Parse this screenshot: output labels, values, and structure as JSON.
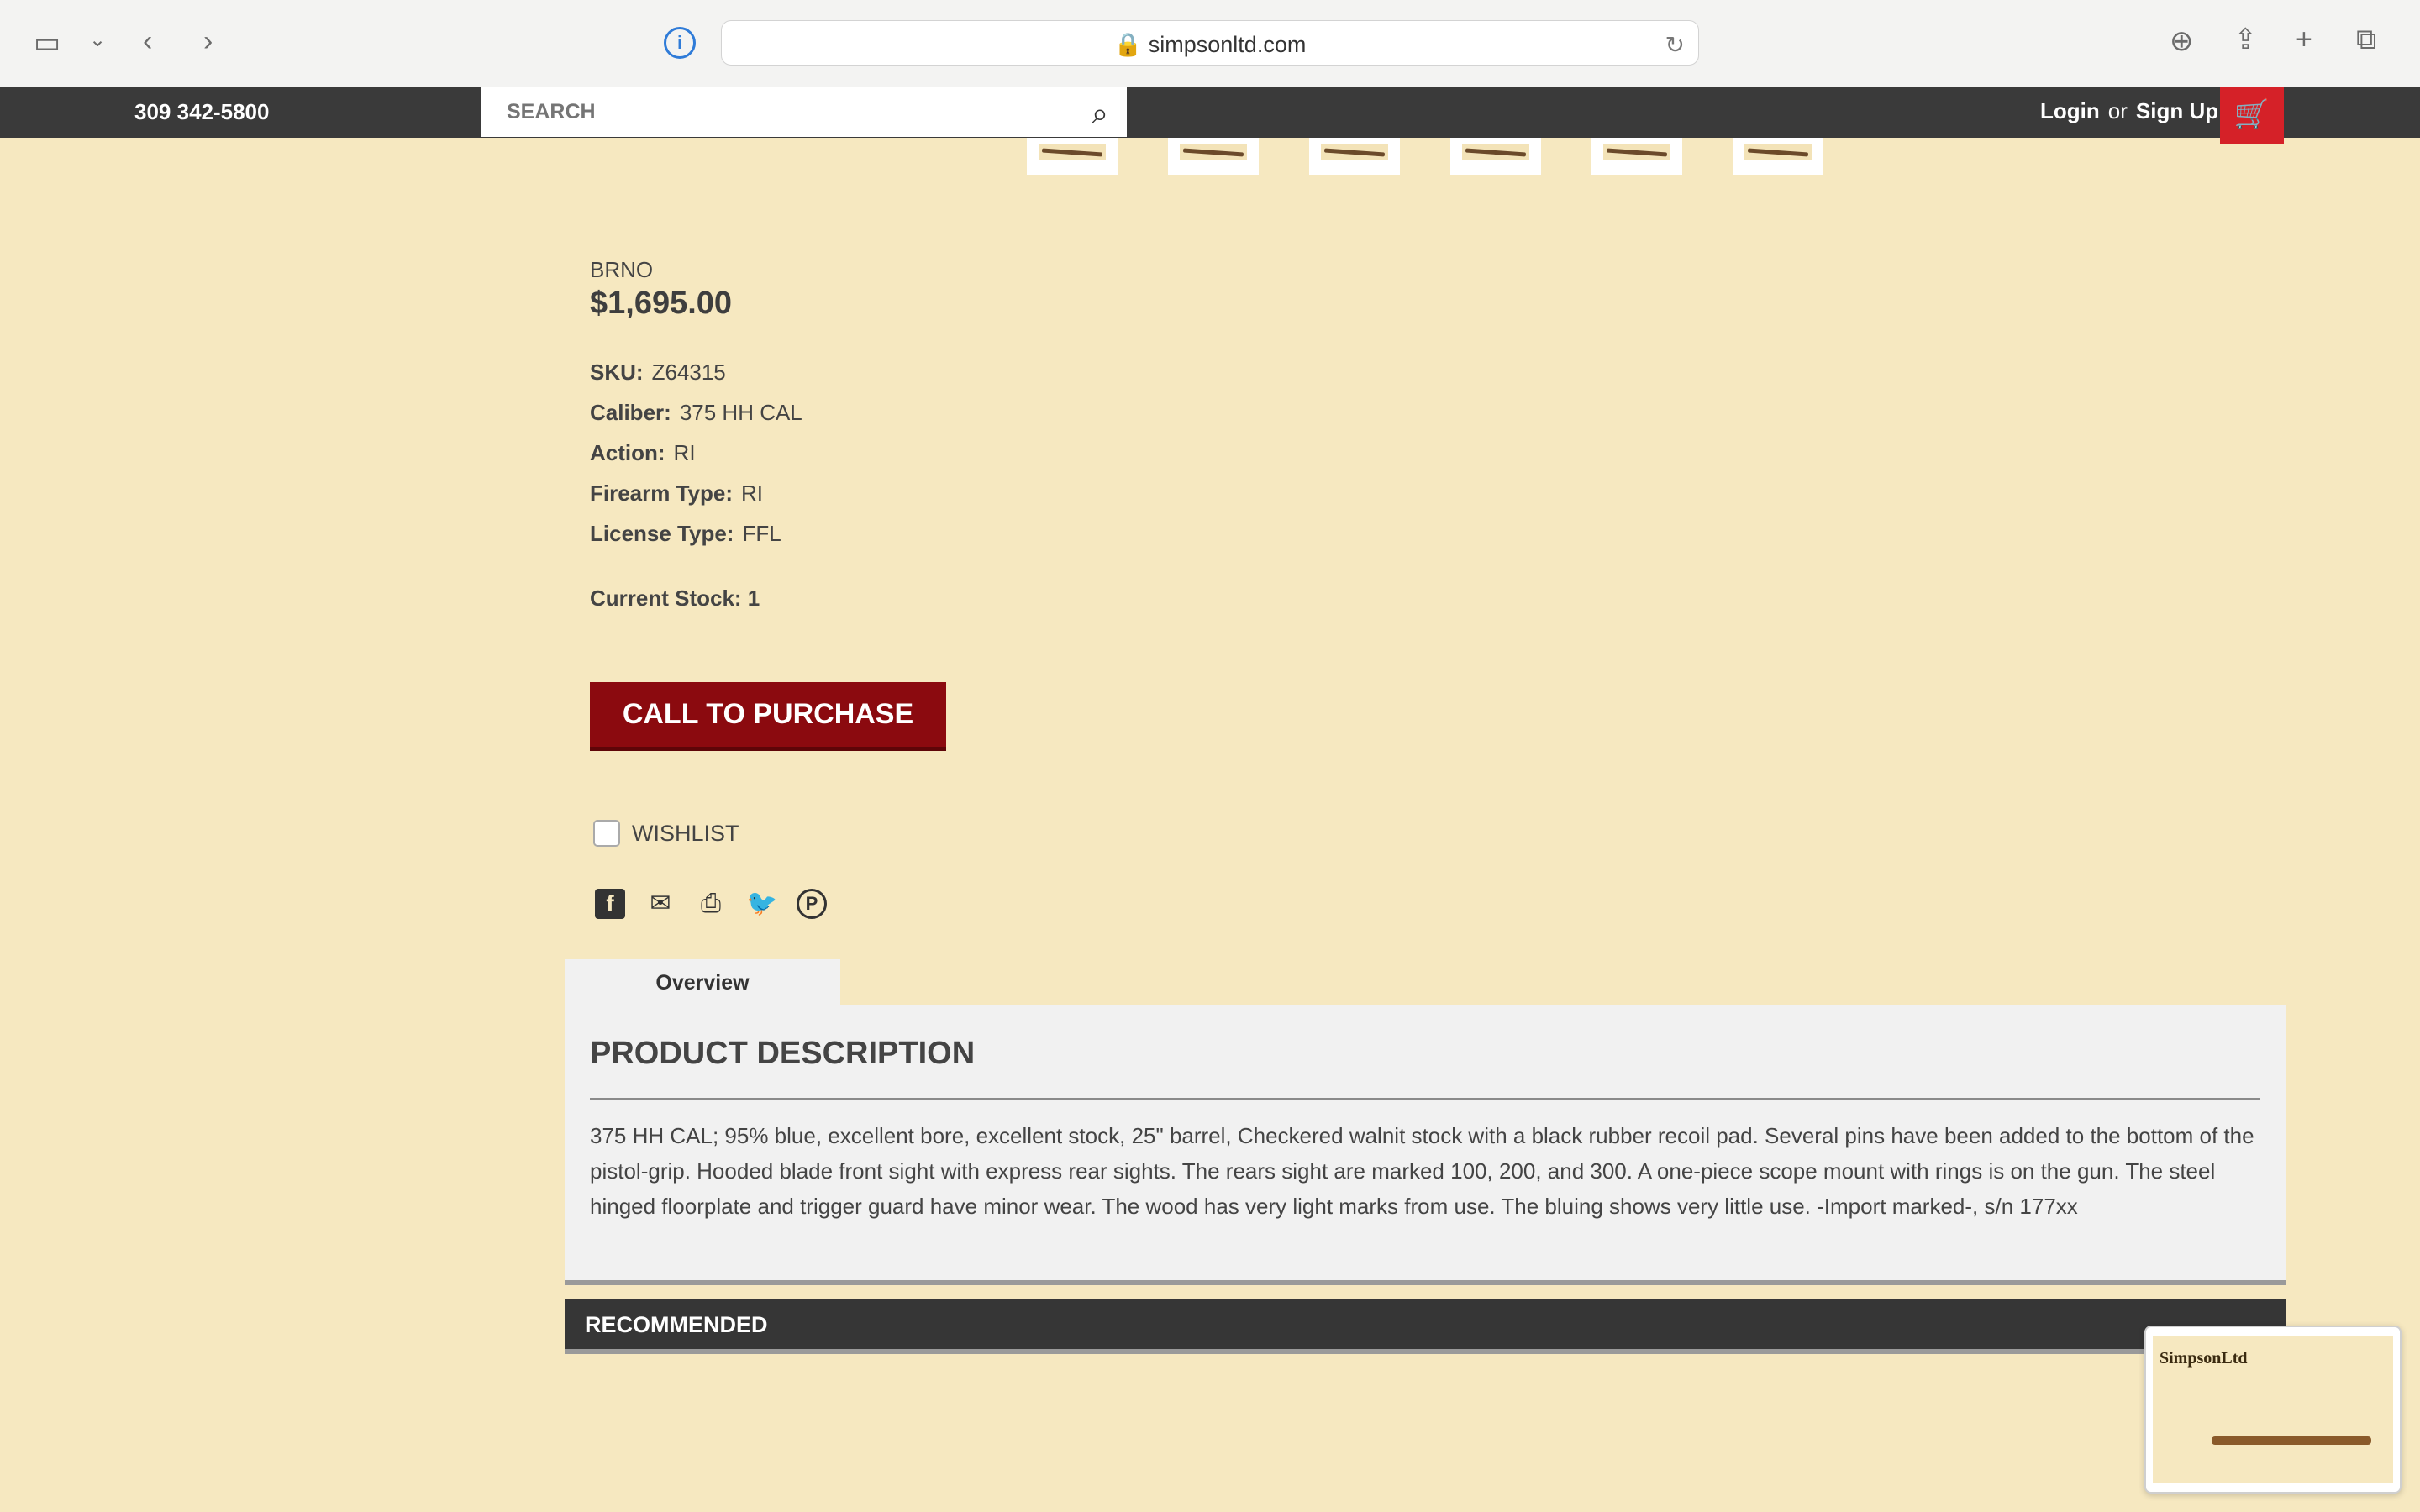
{
  "browser": {
    "url": "simpsonltd.com"
  },
  "header": {
    "phone": "309 342-5800",
    "search_placeholder": "SEARCH",
    "login": "Login",
    "or": "or",
    "signup": "Sign Up"
  },
  "product": {
    "brand": "BRNO",
    "price": "$1,695.00",
    "specs": [
      {
        "label": "SKU:",
        "value": "Z64315"
      },
      {
        "label": "Caliber:",
        "value": "375 HH CAL"
      },
      {
        "label": "Action:",
        "value": "RI"
      },
      {
        "label": "Firearm Type:",
        "value": "RI"
      },
      {
        "label": "License Type:",
        "value": "FFL"
      }
    ],
    "stock": "Current Stock: 1",
    "buy_label": "CALL TO PURCHASE",
    "wishlist": "WISHLIST"
  },
  "tabs": {
    "overview": "Overview"
  },
  "description": {
    "title": "PRODUCT DESCRIPTION",
    "text": "375 HH CAL; 95% blue, excellent bore, excellent stock, 25\" barrel, Checkered walnit stock with a black rubber recoil pad. Several pins have been added to the bottom of the pistol-grip. Hooded blade front sight with express rear sights. The rears sight are marked 100, 200, and 300. A one-piece scope mount with rings is on the gun. The steel hinged floorplate and trigger guard have minor wear. The wood has very light marks from use. The bluing shows very little use. -Import marked-, s/n 177xx"
  },
  "recommended": "RECOMMENDED",
  "preview": {
    "logo": "SimpsonLtd"
  }
}
